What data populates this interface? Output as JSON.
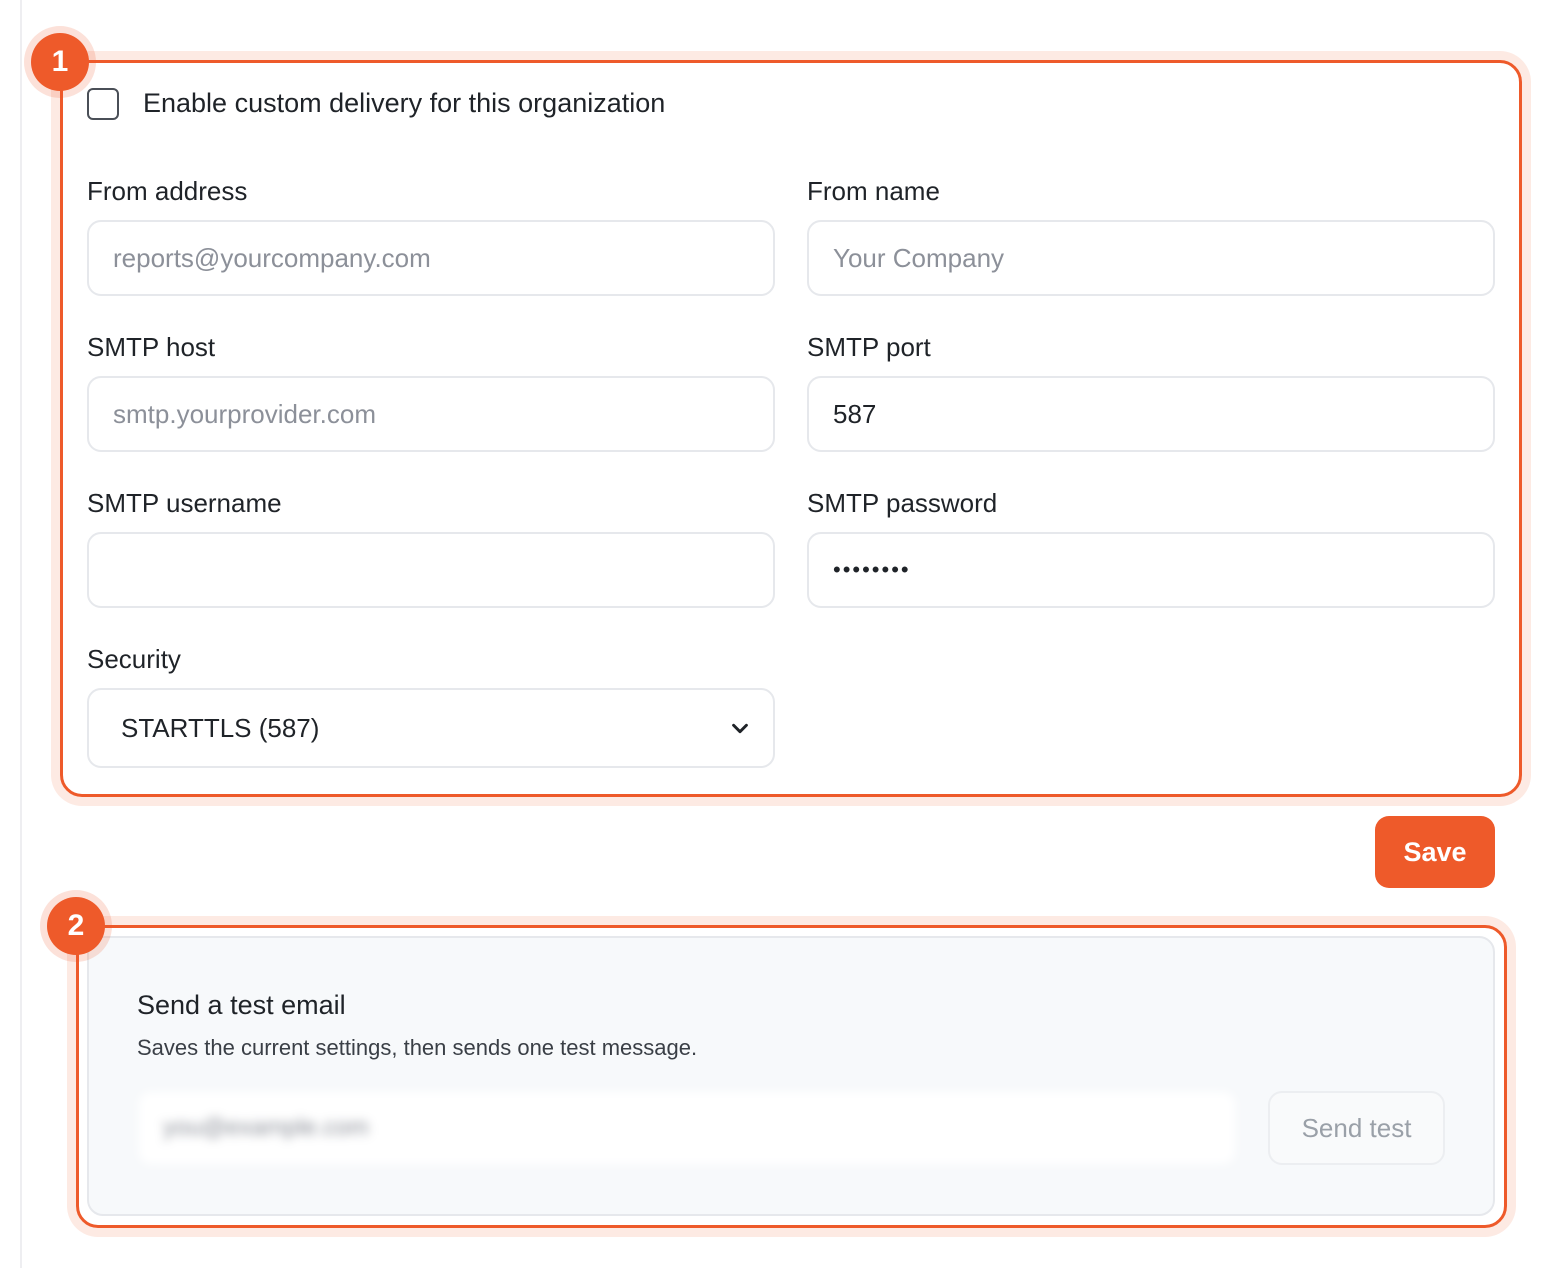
{
  "accent_color": "#ee5a2a",
  "markers": {
    "first": "1",
    "second": "2"
  },
  "delivery": {
    "enable_label": "Enable custom delivery for this organization",
    "enabled": false
  },
  "fields": {
    "from_address": {
      "label": "From address",
      "value": "",
      "placeholder": "reports@yourcompany.com"
    },
    "from_name": {
      "label": "From name",
      "value": "",
      "placeholder": "Your Company"
    },
    "smtp_host": {
      "label": "SMTP host",
      "value": "",
      "placeholder": "smtp.yourprovider.com"
    },
    "smtp_port": {
      "label": "SMTP port",
      "value": "587",
      "placeholder": ""
    },
    "smtp_username": {
      "label": "SMTP username",
      "value": "",
      "placeholder": ""
    },
    "smtp_password": {
      "label": "SMTP password",
      "value": "••••••••",
      "placeholder": ""
    },
    "security": {
      "label": "Security",
      "selected": "STARTTLS (587)",
      "icon": "chevron-down-icon"
    }
  },
  "actions": {
    "save_label": "Save"
  },
  "test_email": {
    "title": "Send a test email",
    "description": "Saves the current settings, then sends one test message.",
    "recipient_value": "you@example.com",
    "send_label": "Send test"
  }
}
